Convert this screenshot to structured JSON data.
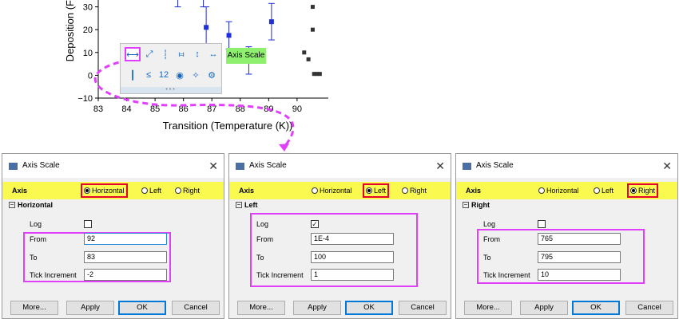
{
  "chart_data": {
    "type": "scatter",
    "xlabel": "Transition (Temperature (K))",
    "ylabel": "Deposition (F",
    "x_ticks": [
      "83",
      "84",
      "85",
      "86",
      "87",
      "88",
      "89",
      "90"
    ],
    "y_ticks": [
      "30",
      "20",
      "10",
      "0",
      "−10"
    ],
    "xlim": [
      83,
      91.1
    ],
    "ylim": [
      -10,
      33
    ],
    "series": [
      {
        "points": [
          {
            "x": 86.8,
            "y": 21,
            "err": 9
          },
          {
            "x": 87.6,
            "y": 17.5,
            "err": 6
          },
          {
            "x": 88.3,
            "y": 6.5,
            "err": 6
          },
          {
            "x": 89.1,
            "y": 23.5,
            "err": 8
          }
        ],
        "extra_error_tops": [
          {
            "x": 85.8,
            "y": 30
          },
          {
            "x": 86.7,
            "y": 30
          }
        ],
        "color": "#1f2ed8"
      },
      {
        "points": [
          {
            "x": 90.55,
            "y": 30
          },
          {
            "x": 90.55,
            "y": 20
          },
          {
            "x": 90.25,
            "y": 10
          },
          {
            "x": 90.4,
            "y": 7
          },
          {
            "x": 90.6,
            "y": 0.6
          },
          {
            "x": 90.7,
            "y": 0.6
          },
          {
            "x": 90.8,
            "y": 0.6
          }
        ],
        "color": "#333333"
      }
    ]
  },
  "toolbar": {
    "tooltip": "Axis Scale",
    "buttons": [
      "⟷",
      "⤢",
      "┆",
      "⧦",
      "↕",
      "↔",
      "┃",
      "≤",
      "12",
      "◉",
      "✧",
      "⚙"
    ]
  },
  "dialogs": [
    {
      "title": "Axis Scale",
      "axis_label": "Axis",
      "options": [
        "Horizontal",
        "Left",
        "Right"
      ],
      "selected": 0,
      "section": "Horizontal",
      "log_label": "Log",
      "log_checked": false,
      "from_label": "From",
      "from_value": "92",
      "to_label": "To",
      "to_value": "83",
      "third_label": "Tick Increment",
      "third_value": "-2",
      "buttons": {
        "more": "More...",
        "apply": "Apply",
        "ok": "OK",
        "cancel": "Cancel"
      }
    },
    {
      "title": "Axis Scale",
      "axis_label": "Axis",
      "options": [
        "Horizontal",
        "Left",
        "Right"
      ],
      "selected": 1,
      "section": "Left",
      "log_label": "Log",
      "log_checked": true,
      "from_label": "From",
      "from_value": "1E-4",
      "to_label": "To",
      "to_value": "100",
      "third_label": "Tick Increment",
      "third_value": "1",
      "buttons": {
        "more": "More...",
        "apply": "Apply",
        "ok": "OK",
        "cancel": "Cancel"
      }
    },
    {
      "title": "Axis Scale",
      "axis_label": "Axis",
      "options": [
        "Horizontal",
        "Left",
        "Right"
      ],
      "selected": 2,
      "section": "Right",
      "log_label": "Log",
      "log_checked": false,
      "from_label": "From",
      "from_value": "765",
      "to_label": "To",
      "to_value": "795",
      "third_label": "Tick Increment",
      "third_value": "10",
      "buttons": {
        "more": "More...",
        "apply": "Apply",
        "ok": "OK",
        "cancel": "Cancel"
      }
    }
  ],
  "colors": {
    "highlight_magenta": "#e040fb",
    "selection_red": "#e6002e",
    "axis_row_yellow": "#f9f94f",
    "tooltip_green": "#8ff06f",
    "ok_border_blue": "#0078d7"
  }
}
